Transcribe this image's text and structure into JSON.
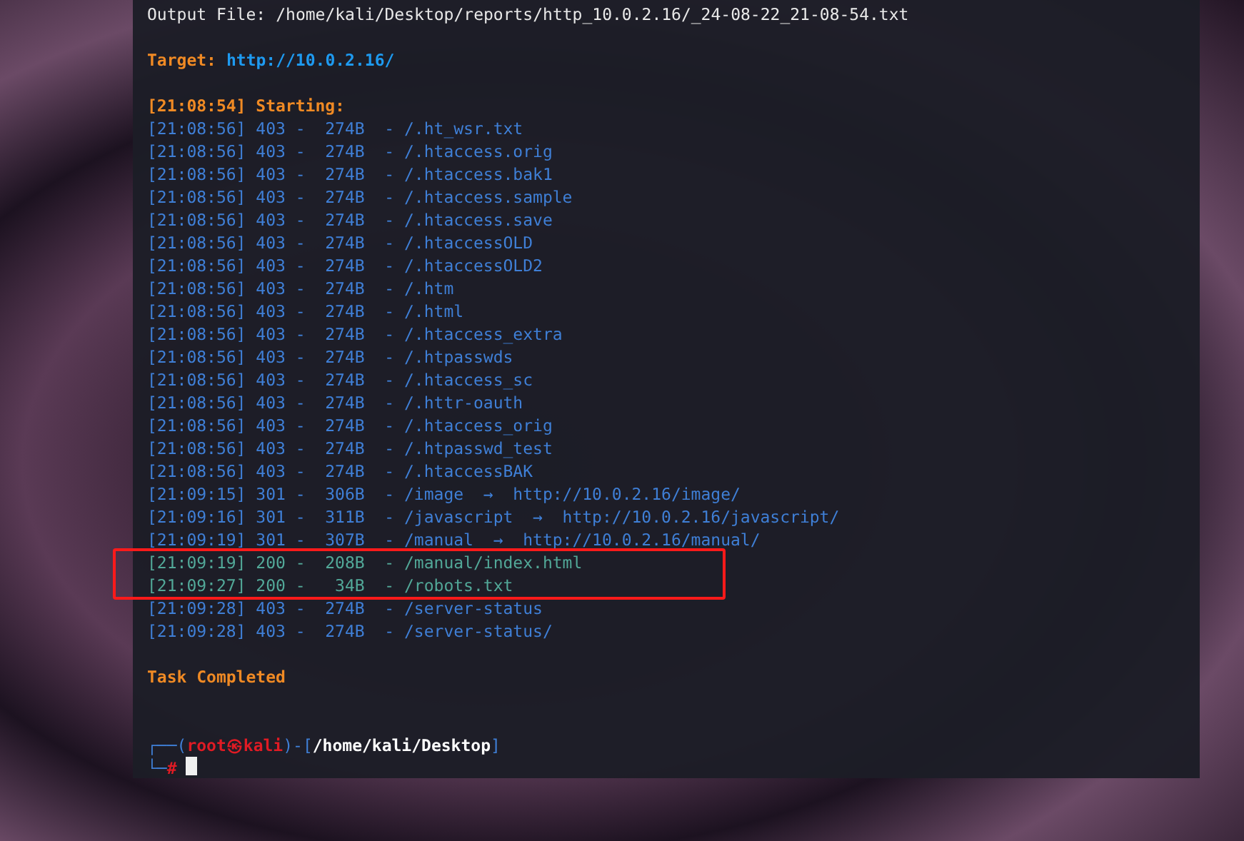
{
  "terminal": {
    "output_file": {
      "label": "Output File:",
      "value": "/home/kali/Desktop/reports/http_10.0.2.16/_24-08-22_21-08-54.txt"
    },
    "target": {
      "label": "Target:",
      "value": "http://10.0.2.16/"
    },
    "starting": "[21:08:54] Starting:",
    "rows": [
      {
        "kind": "forbidden",
        "text": "[21:08:56] 403 -  274B  - /.ht_wsr.txt",
        "boxed": false
      },
      {
        "kind": "forbidden",
        "text": "[21:08:56] 403 -  274B  - /.htaccess.orig",
        "boxed": false
      },
      {
        "kind": "forbidden",
        "text": "[21:08:56] 403 -  274B  - /.htaccess.bak1",
        "boxed": false
      },
      {
        "kind": "forbidden",
        "text": "[21:08:56] 403 -  274B  - /.htaccess.sample",
        "boxed": false
      },
      {
        "kind": "forbidden",
        "text": "[21:08:56] 403 -  274B  - /.htaccess.save",
        "boxed": false
      },
      {
        "kind": "forbidden",
        "text": "[21:08:56] 403 -  274B  - /.htaccessOLD",
        "boxed": false
      },
      {
        "kind": "forbidden",
        "text": "[21:08:56] 403 -  274B  - /.htaccessOLD2",
        "boxed": false
      },
      {
        "kind": "forbidden",
        "text": "[21:08:56] 403 -  274B  - /.htm",
        "boxed": false
      },
      {
        "kind": "forbidden",
        "text": "[21:08:56] 403 -  274B  - /.html",
        "boxed": false
      },
      {
        "kind": "forbidden",
        "text": "[21:08:56] 403 -  274B  - /.htaccess_extra",
        "boxed": false
      },
      {
        "kind": "forbidden",
        "text": "[21:08:56] 403 -  274B  - /.htpasswds",
        "boxed": false
      },
      {
        "kind": "forbidden",
        "text": "[21:08:56] 403 -  274B  - /.htaccess_sc",
        "boxed": false
      },
      {
        "kind": "forbidden",
        "text": "[21:08:56] 403 -  274B  - /.httr-oauth",
        "boxed": false
      },
      {
        "kind": "forbidden",
        "text": "[21:08:56] 403 -  274B  - /.htaccess_orig",
        "boxed": false
      },
      {
        "kind": "forbidden",
        "text": "[21:08:56] 403 -  274B  - /.htpasswd_test",
        "boxed": false
      },
      {
        "kind": "forbidden",
        "text": "[21:08:56] 403 -  274B  - /.htaccessBAK",
        "boxed": false
      },
      {
        "kind": "redirect",
        "text": "[21:09:15] 301 -  306B  - /image  →  http://10.0.2.16/image/",
        "boxed": false
      },
      {
        "kind": "redirect",
        "text": "[21:09:16] 301 -  311B  - /javascript  →  http://10.0.2.16/javascript/",
        "boxed": false
      },
      {
        "kind": "redirect",
        "text": "[21:09:19] 301 -  307B  - /manual  →  http://10.0.2.16/manual/",
        "boxed": false
      },
      {
        "kind": "success",
        "text": "[21:09:19] 200 -  208B  - /manual/index.html",
        "boxed": true
      },
      {
        "kind": "success",
        "text": "[21:09:27] 200 -   34B  - /robots.txt",
        "boxed": true
      },
      {
        "kind": "forbidden",
        "text": "[21:09:28] 403 -  274B  - /server-status",
        "boxed": false
      },
      {
        "kind": "forbidden",
        "text": "[21:09:28] 403 -  274B  - /server-status/",
        "boxed": false
      }
    ],
    "completed": "Task Completed",
    "prompt_line1": [
      {
        "kind": "frame",
        "text": "┌──("
      },
      {
        "kind": "user",
        "text": "root㉿kali"
      },
      {
        "kind": "frame",
        "text": ")-["
      },
      {
        "kind": "path",
        "text": "/home/kali/Desktop"
      },
      {
        "kind": "frame",
        "text": "]"
      }
    ],
    "prompt_line2": [
      {
        "kind": "frame",
        "text": "└─"
      },
      {
        "kind": "symbol",
        "text": "#"
      }
    ]
  }
}
